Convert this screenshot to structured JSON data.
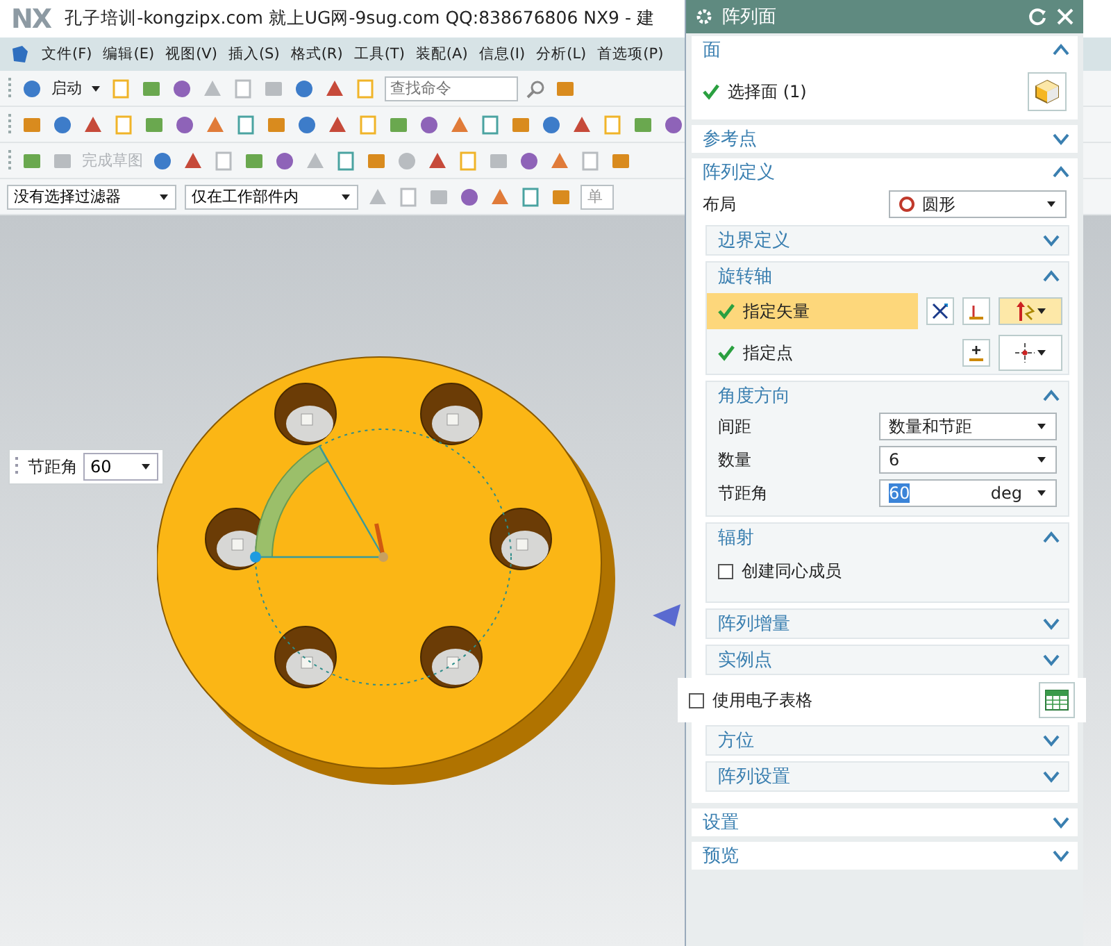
{
  "window": {
    "logo": "NX",
    "title": "孔子培训-kongzipx.com 就上UG网-9sug.com QQ:838676806 NX9 - 建"
  },
  "menu": [
    "文件(F)",
    "编辑(E)",
    "视图(V)",
    "插入(S)",
    "格式(R)",
    "工具(T)",
    "装配(A)",
    "信息(I)",
    "分析(L)",
    "首选项(P)"
  ],
  "toolbar": {
    "start_label": "启动",
    "search": {
      "placeholder": "查找命令"
    }
  },
  "sketch_toolbar": {
    "finish_sketch": {
      "label": "完成草图",
      "disabled": true
    }
  },
  "selection_bar": {
    "filter": "没有选择过滤器",
    "scope": "仅在工作部件内",
    "mode": "单"
  },
  "viewport": {
    "popup": {
      "label": "节距角",
      "value": "60"
    }
  },
  "dialog": {
    "title": "阵列面",
    "sections": [
      {
        "kind": "face",
        "title": "面",
        "expanded": true,
        "select_label": "选择面 (1)",
        "done": true
      },
      {
        "kind": "plain",
        "title": "参考点",
        "expanded": false
      },
      {
        "kind": "pattern",
        "title": "阵列定义",
        "expanded": true,
        "layout_label": "布局",
        "layout_value": "圆形",
        "groups": [
          {
            "kind": "plain",
            "title": "边界定义",
            "expanded": false
          },
          {
            "kind": "axis",
            "title": "旋转轴",
            "expanded": true,
            "rows": [
              {
                "label": "指定矢量",
                "done": true,
                "selected": true
              },
              {
                "label": "指定点",
                "done": true,
                "selected": false
              }
            ]
          },
          {
            "kind": "fields",
            "title": "角度方向",
            "expanded": true,
            "fields": [
              {
                "label": "间距",
                "value": "数量和节距"
              },
              {
                "label": "数量",
                "value": "6"
              },
              {
                "label": "节距角",
                "value": "60",
                "unit": "deg"
              }
            ]
          },
          {
            "kind": "checks",
            "title": "辐射",
            "expanded": true,
            "checks": [
              {
                "label": "创建同心成员",
                "checked": false
              }
            ]
          },
          {
            "kind": "plain",
            "title": "阵列增量",
            "expanded": false
          },
          {
            "kind": "plain",
            "title": "实例点",
            "expanded": false
          },
          {
            "kind": "check_row",
            "label": "使用电子表格",
            "checked": false
          },
          {
            "kind": "plain",
            "title": "方位",
            "expanded": false
          },
          {
            "kind": "plain",
            "title": "阵列设置",
            "expanded": false
          }
        ]
      },
      {
        "kind": "plain",
        "title": "设置",
        "expanded": false
      },
      {
        "kind": "plain",
        "title": "预览",
        "expanded": false
      }
    ]
  }
}
